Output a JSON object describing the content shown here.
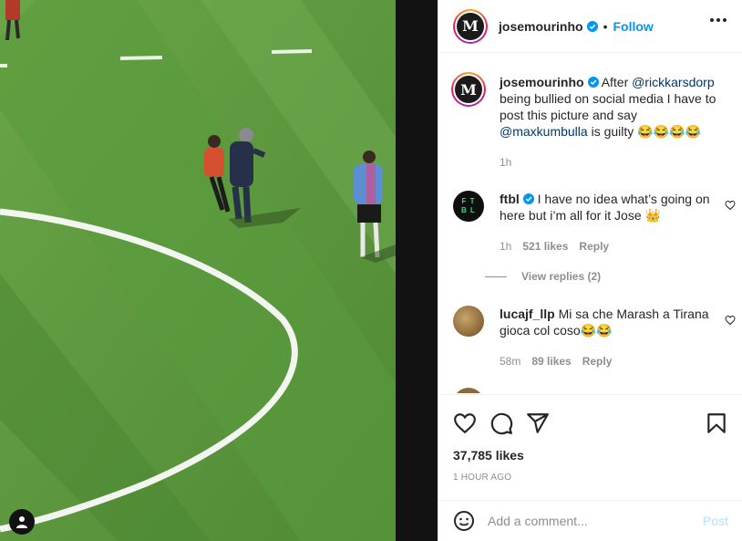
{
  "post": {
    "author": "josemourinho",
    "follow_label": "Follow",
    "separator": "•",
    "avatar_letter": "M"
  },
  "caption": {
    "author": "josemourinho",
    "text_1": "After ",
    "mention_1": "@rickkarsdorp",
    "text_2": " being bullied on social media I have to post this picture and say ",
    "mention_2": "@maxkumbulla",
    "text_3": " is guilty 😂😂😂😂",
    "time": "1h"
  },
  "comments": [
    {
      "author": "ftbl",
      "avatar_text": [
        "F T",
        "B L"
      ],
      "text": " I have no idea what’s going on here but i’m all for it Jose 👑",
      "time": "1h",
      "likes": "521 likes",
      "reply_label": "Reply",
      "view_replies": "View replies (2)"
    },
    {
      "author": "lucajf_llp",
      "text": " Mi sa che Marash a Tirana gioca col coso😂😂",
      "time": "58m",
      "likes": "89 likes",
      "reply_label": "Reply"
    }
  ],
  "footer": {
    "likes": "37,785 likes",
    "time_ago": "1 HOUR AGO",
    "comment_placeholder": "Add a comment...",
    "post_label": "Post"
  },
  "icons": {
    "like": "heart-icon",
    "comment": "comment-icon",
    "share": "paper-plane-icon",
    "save": "bookmark-icon",
    "emoji": "smiley-icon",
    "tag": "person-tag-icon",
    "more": "more-options-icon",
    "verified": "verified-badge-icon"
  },
  "colors": {
    "link": "#0095f6",
    "mention": "#00376b",
    "muted": "#8e8e8e",
    "grass": "#5f9a40"
  }
}
